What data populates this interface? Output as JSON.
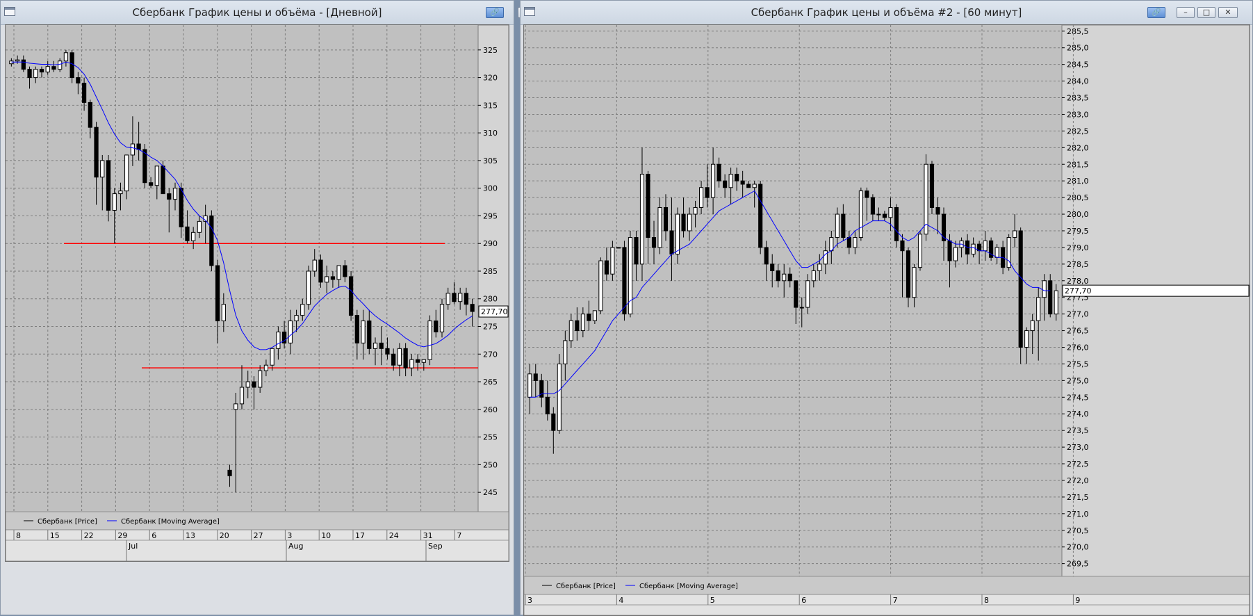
{
  "left": {
    "title": "Сбербанк График цены и объёма - [Дневной]",
    "y_ticks": [
      "325",
      "320",
      "315",
      "310",
      "305",
      "300",
      "295",
      "290",
      "285",
      "280",
      "275",
      "270",
      "265",
      "260",
      "255",
      "250",
      "245"
    ],
    "last_price": "277,70",
    "day_labels": [
      "8",
      "15",
      "22",
      "29",
      "6",
      "13",
      "20",
      "27",
      "3",
      "10",
      "17",
      "24",
      "31",
      "7"
    ],
    "month_labels": [
      "Jul",
      "Aug",
      "Sep"
    ],
    "legend": {
      "price": "Сбербанк [Price]",
      "ma": "Сбербанк [Moving Average]"
    }
  },
  "right": {
    "title": "Сбербанк График цены и объёма #2 - [60 минут]",
    "y_ticks": [
      "285,5",
      "285,0",
      "284,5",
      "284,0",
      "283,5",
      "283,0",
      "282,5",
      "282,0",
      "281,5",
      "281,0",
      "280,5",
      "280,0",
      "279,5",
      "279,0",
      "278,5",
      "278,0",
      "277,5",
      "277,0",
      "276,5",
      "276,0",
      "275,5",
      "275,0",
      "274,5",
      "274,0",
      "273,5",
      "273,0",
      "272,5",
      "272,0",
      "271,5",
      "271,0",
      "270,5",
      "270,0",
      "269,5"
    ],
    "last_price": "277,70",
    "day_labels": [
      "3",
      "4",
      "5",
      "6",
      "7",
      "8",
      "9"
    ],
    "legend": {
      "price": "Сбербанк [Price]",
      "ma": "Сбербанк [Moving Average]"
    }
  },
  "colors": {
    "bull": "#ffffff",
    "bear": "#000000",
    "ma": "#0000ff",
    "level": "#ff0000",
    "bg": "#c0c0c0"
  },
  "chart_data": [
    {
      "type": "candlestick",
      "title": "Сбербанк График цены и объёма - [Дневной]",
      "ylim": [
        242,
        329
      ],
      "grid": true,
      "legend": "bottom-left",
      "series": [
        {
          "name": "Сбербанк [Price]"
        },
        {
          "name": "Сбербанк [Moving Average]"
        }
      ],
      "candles": [
        [
          322.5,
          323.5,
          322,
          323
        ],
        [
          323,
          324,
          322.5,
          323.2
        ],
        [
          323.2,
          324,
          321,
          321.5
        ],
        [
          321.5,
          322,
          318,
          320
        ],
        [
          320,
          322,
          319,
          321.5
        ],
        [
          321.5,
          322,
          320,
          321
        ],
        [
          321,
          323,
          320.5,
          322
        ],
        [
          322,
          323,
          321,
          321.5
        ],
        [
          321.5,
          323.5,
          321,
          323
        ],
        [
          323,
          325,
          322,
          324.5
        ],
        [
          324.5,
          325,
          319,
          320
        ],
        [
          320,
          321,
          317,
          319
        ],
        [
          319,
          320,
          314,
          315.5
        ],
        [
          315.5,
          316,
          309,
          311
        ],
        [
          311,
          312,
          297,
          302
        ],
        [
          302,
          306,
          296,
          305
        ],
        [
          305,
          306,
          294,
          296
        ],
        [
          296,
          300,
          290,
          299
        ],
        [
          299,
          301,
          296,
          299.5
        ],
        [
          299.5,
          306,
          298,
          306
        ],
        [
          306,
          313,
          304,
          308
        ],
        [
          308,
          312,
          305,
          307
        ],
        [
          307,
          308,
          300,
          301
        ],
        [
          301,
          302,
          300,
          300.5
        ],
        [
          300.5,
          304,
          298,
          304
        ],
        [
          304,
          305,
          299,
          299
        ],
        [
          299,
          300,
          292,
          298
        ],
        [
          298,
          301,
          296,
          300
        ],
        [
          300,
          301,
          291,
          293
        ],
        [
          293,
          296,
          290,
          290.5
        ],
        [
          290.5,
          293,
          289,
          292
        ],
        [
          292,
          295,
          291,
          294
        ],
        [
          294,
          297,
          290,
          295
        ],
        [
          295,
          296,
          285,
          286
        ],
        [
          286,
          287,
          272,
          276
        ],
        [
          276,
          281,
          274,
          279
        ],
        [
          249,
          250,
          246,
          248
        ],
        [
          260,
          263,
          245,
          261
        ],
        [
          261,
          268,
          260,
          264
        ],
        [
          264,
          267,
          262,
          265
        ],
        [
          265,
          266,
          260,
          264
        ],
        [
          264,
          268,
          263,
          267
        ],
        [
          267,
          269,
          266,
          268
        ],
        [
          268,
          271,
          267,
          271
        ],
        [
          271,
          275,
          269,
          274
        ],
        [
          274,
          276,
          271,
          272
        ],
        [
          272,
          278,
          270,
          276
        ],
        [
          276,
          278,
          274,
          277
        ],
        [
          277,
          280,
          276,
          279
        ],
        [
          279,
          286,
          278,
          285
        ],
        [
          285,
          289,
          284,
          287
        ],
        [
          287,
          288,
          282,
          283
        ],
        [
          283,
          286,
          281,
          284
        ],
        [
          284,
          285,
          282,
          283.5
        ],
        [
          283.5,
          286,
          282,
          286
        ],
        [
          286,
          287,
          283,
          284
        ],
        [
          284,
          285,
          276,
          277
        ],
        [
          277,
          278,
          269,
          272
        ],
        [
          272,
          278,
          269,
          276
        ],
        [
          276,
          278,
          270,
          271
        ],
        [
          271,
          273,
          268,
          272
        ],
        [
          272,
          275,
          268,
          271
        ],
        [
          271,
          273,
          269,
          270
        ],
        [
          270,
          271,
          267,
          268
        ],
        [
          268,
          272,
          266,
          271
        ],
        [
          271,
          272,
          266,
          267.5
        ],
        [
          267.5,
          270,
          266,
          269
        ],
        [
          269,
          270,
          267,
          268.5
        ],
        [
          268.5,
          269,
          267,
          269
        ],
        [
          269,
          277,
          268,
          276
        ],
        [
          276,
          278,
          273,
          274
        ],
        [
          274,
          280,
          273,
          279
        ],
        [
          279,
          282,
          278,
          281
        ],
        [
          281,
          283,
          279,
          279.5
        ],
        [
          279.5,
          282,
          278,
          281
        ],
        [
          281,
          282,
          277,
          279
        ],
        [
          279,
          280,
          275,
          277.7
        ]
      ],
      "moving_average": [
        322.8,
        322.8,
        322.8,
        322.6,
        322.5,
        322.4,
        322.4,
        322.3,
        322.4,
        322.8,
        322.5,
        321.8,
        320.6,
        318.8,
        316.5,
        314.2,
        311.8,
        309.8,
        308.2,
        307.4,
        307.3,
        307,
        306.4,
        305.6,
        305,
        304,
        302.8,
        301.6,
        299.8,
        297.8,
        296.2,
        295,
        294.2,
        292.8,
        290.5,
        286.5,
        281.5,
        277,
        274.2,
        272.5,
        271.3,
        270.8,
        270.8,
        271.2,
        271.9,
        272.4,
        273.4,
        274.3,
        275.5,
        277.1,
        278.7,
        279.8,
        280.8,
        281.5,
        282.1,
        282.3,
        281.5,
        280.2,
        279.1,
        277.9,
        276.9,
        276.1,
        275.4,
        274.6,
        273.8,
        272.9,
        272.2,
        271.6,
        271.3,
        271.6,
        271.9,
        272.6,
        273.4,
        274.5,
        275.4,
        276.2,
        276.9
      ]
    },
    {
      "type": "candlestick",
      "title": "Сбербанк График цены и объёма #2 - [60 минут]",
      "ylim": [
        269.2,
        285.6
      ],
      "grid": true,
      "legend": "bottom-left",
      "series": [
        {
          "name": "Сбербанк [Price]"
        },
        {
          "name": "Сбербанк [Moving Average]"
        }
      ],
      "candles": [
        [
          274.5,
          275.5,
          274,
          275.2
        ],
        [
          275.2,
          275.5,
          274.5,
          275
        ],
        [
          275,
          275.2,
          274.2,
          274.5
        ],
        [
          274.5,
          275,
          273.8,
          274
        ],
        [
          274,
          274.2,
          272.8,
          273.5
        ],
        [
          273.5,
          275.8,
          273.4,
          275.5
        ],
        [
          275.5,
          276.5,
          275,
          276.2
        ],
        [
          276.2,
          277,
          276,
          276.8
        ],
        [
          276.8,
          277.2,
          276.2,
          276.5
        ],
        [
          276.5,
          277.2,
          276.3,
          277
        ],
        [
          277,
          277.4,
          276.5,
          276.8
        ],
        [
          276.8,
          277.1,
          276.7,
          277.1
        ],
        [
          277.1,
          278.7,
          277,
          278.6
        ],
        [
          278.6,
          279,
          278,
          278.2
        ],
        [
          278.2,
          279.2,
          278,
          279
        ],
        [
          279,
          279,
          279,
          279
        ],
        [
          279,
          279.2,
          276.8,
          277
        ],
        [
          277,
          279.5,
          276.9,
          279.3
        ],
        [
          279.3,
          279.5,
          278,
          278.5
        ],
        [
          278.5,
          282,
          278,
          281.2
        ],
        [
          281.2,
          281.3,
          278.5,
          279.3
        ],
        [
          279.3,
          279.8,
          278.5,
          279
        ],
        [
          279,
          280.5,
          278.8,
          280.2
        ],
        [
          280.2,
          280.6,
          279.2,
          279.5
        ],
        [
          279.5,
          280.5,
          278,
          278.8
        ],
        [
          278.8,
          280.2,
          278.5,
          280
        ],
        [
          280,
          280.5,
          279.3,
          279.5
        ],
        [
          279.5,
          280.2,
          279.2,
          280
        ],
        [
          280,
          280.4,
          279.6,
          280.2
        ],
        [
          280.2,
          281,
          280,
          280.8
        ],
        [
          280.8,
          281.5,
          280.2,
          280.5
        ],
        [
          280.5,
          282,
          280,
          281.5
        ],
        [
          281.5,
          281.7,
          280.8,
          281
        ],
        [
          281,
          281.2,
          280.5,
          280.8
        ],
        [
          280.8,
          281.4,
          280.3,
          281.2
        ],
        [
          281.2,
          281.4,
          280.7,
          281
        ],
        [
          281,
          281.3,
          280.5,
          280.9
        ],
        [
          280.9,
          281,
          280.8,
          280.8
        ],
        [
          280.8,
          281,
          280.2,
          280.9
        ],
        [
          280.9,
          281,
          278.8,
          279
        ],
        [
          279,
          279.2,
          278,
          278.5
        ],
        [
          278.5,
          278.8,
          277.8,
          278.3
        ],
        [
          278.3,
          278.5,
          277.8,
          278
        ],
        [
          278,
          278.5,
          277.5,
          278.2
        ],
        [
          278.2,
          278.4,
          277.8,
          278
        ],
        [
          278,
          278,
          276.7,
          277.2
        ],
        [
          277.2,
          277.5,
          276.6,
          277.2
        ],
        [
          277.2,
          278.2,
          277,
          278
        ],
        [
          278,
          278.5,
          277.8,
          278.3
        ],
        [
          278.3,
          278.8,
          278,
          278.5
        ],
        [
          278.5,
          279.2,
          278.2,
          278.9
        ],
        [
          278.9,
          279.5,
          278.5,
          279.3
        ],
        [
          279.3,
          280.2,
          279,
          280
        ],
        [
          280,
          280.3,
          279.2,
          279.3
        ],
        [
          279.3,
          279.5,
          278.8,
          279
        ],
        [
          279,
          279.5,
          278.8,
          279.3
        ],
        [
          279.3,
          280.8,
          279.2,
          280.7
        ],
        [
          280.7,
          280.8,
          279.8,
          280.5
        ],
        [
          280.5,
          280.6,
          279.8,
          280
        ],
        [
          280,
          280.2,
          279.8,
          280
        ],
        [
          280,
          280.1,
          279.8,
          279.9
        ],
        [
          279.9,
          280.5,
          279.5,
          280.2
        ],
        [
          280.2,
          280.3,
          279,
          279.2
        ],
        [
          279.2,
          279.4,
          277.5,
          278.9
        ],
        [
          278.9,
          279,
          277.2,
          277.5
        ],
        [
          277.5,
          278.5,
          277.2,
          278.4
        ],
        [
          278.4,
          279.5,
          278.3,
          279.4
        ],
        [
          279.4,
          281.8,
          279.2,
          281.5
        ],
        [
          281.5,
          281.6,
          280,
          280.2
        ],
        [
          280.2,
          280.5,
          279.4,
          280
        ],
        [
          280,
          280.2,
          278.6,
          279.2
        ],
        [
          279.2,
          279.4,
          277.8,
          278.6
        ],
        [
          278.6,
          279.2,
          278.4,
          279
        ],
        [
          279,
          279.3,
          278.7,
          279.2
        ],
        [
          279.2,
          279.4,
          278.5,
          278.8
        ],
        [
          278.8,
          279.3,
          278.7,
          279.1
        ],
        [
          279.1,
          279.2,
          278.5,
          278.9
        ],
        [
          278.9,
          279.5,
          278.6,
          279.2
        ],
        [
          279.2,
          279.3,
          278.6,
          278.7
        ],
        [
          278.7,
          279.1,
          278.5,
          279
        ],
        [
          279,
          279.2,
          278.2,
          278.4
        ],
        [
          278.4,
          279.4,
          278.3,
          279.3
        ],
        [
          279.3,
          280,
          279,
          279.5
        ],
        [
          279.5,
          279.6,
          275.5,
          276
        ],
        [
          276,
          276.6,
          275.5,
          276.5
        ],
        [
          276.5,
          277,
          275.8,
          276.8
        ],
        [
          276.8,
          277.8,
          275.6,
          277.5
        ],
        [
          277.5,
          278.2,
          276.8,
          278
        ],
        [
          278,
          278.2,
          276.9,
          277
        ],
        [
          277,
          277.9,
          276.8,
          277.7
        ]
      ],
      "moving_average": [
        274.5,
        274.5,
        274.6,
        274.6,
        274.6,
        274.7,
        274.9,
        275.1,
        275.3,
        275.5,
        275.7,
        275.9,
        276.2,
        276.5,
        276.8,
        277,
        277.2,
        277.4,
        277.5,
        277.8,
        278,
        278.2,
        278.4,
        278.6,
        278.8,
        278.9,
        279,
        279.1,
        279.3,
        279.5,
        279.7,
        279.9,
        280.1,
        280.2,
        280.3,
        280.4,
        280.5,
        280.6,
        280.7,
        280.4,
        280.1,
        279.8,
        279.5,
        279.2,
        278.9,
        278.6,
        278.4,
        278.4,
        278.5,
        278.6,
        278.8,
        278.9,
        279.1,
        279.2,
        279.3,
        279.5,
        279.6,
        279.7,
        279.8,
        279.8,
        279.8,
        279.7,
        279.5,
        279.3,
        279.2,
        279.3,
        279.5,
        279.7,
        279.6,
        279.5,
        279.3,
        279.2,
        279.1,
        279.1,
        279,
        279,
        278.9,
        278.9,
        278.8,
        278.7,
        278.7,
        278.6,
        278.3,
        278.1,
        277.9,
        277.8,
        277.8,
        277.7,
        277.7
      ]
    }
  ]
}
